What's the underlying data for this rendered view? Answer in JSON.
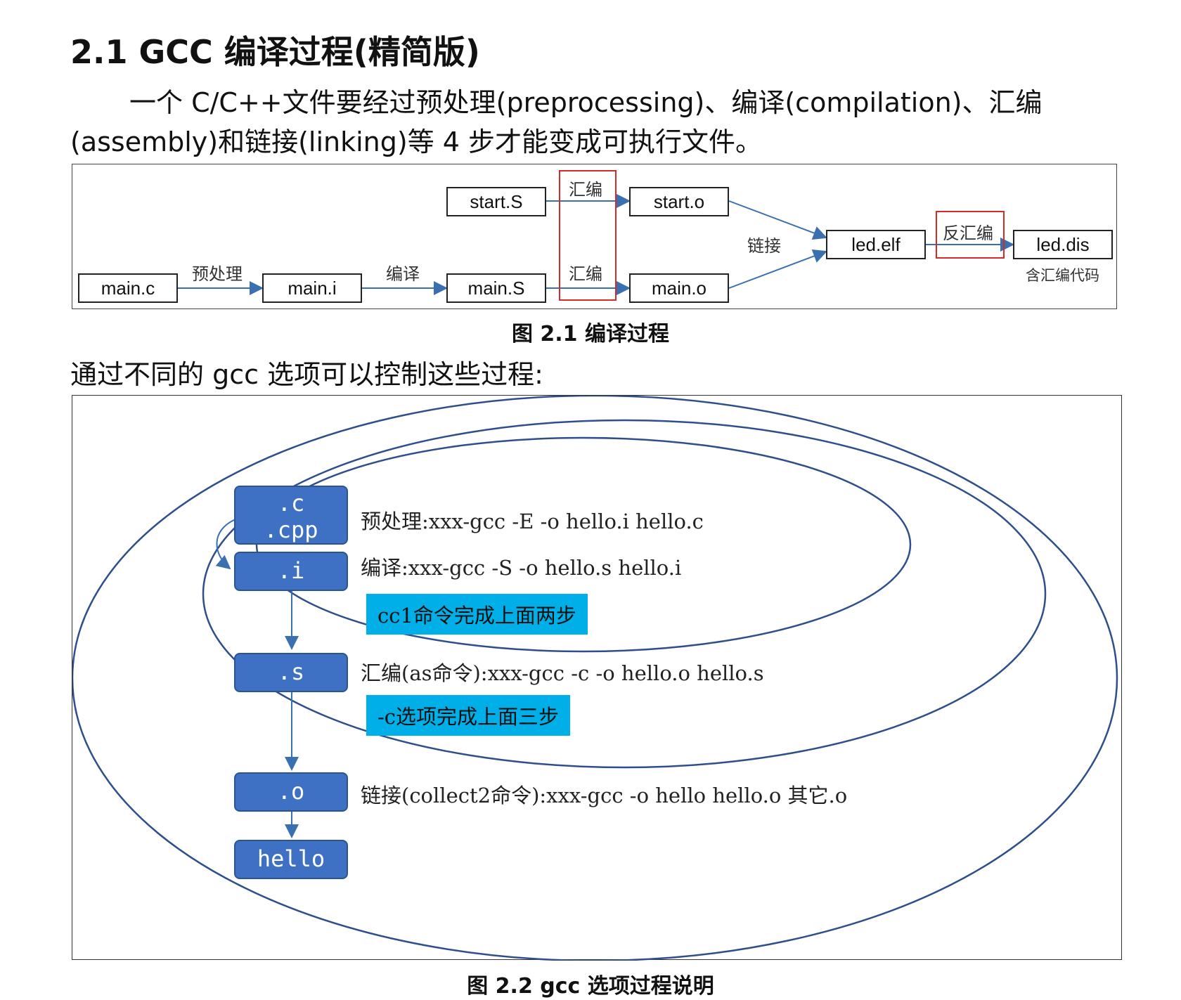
{
  "section_title": "2.1 GCC 编译过程(精简版)",
  "intro": "一个 C/C++文件要经过预处理(preprocessing)、编译(compilation)、汇编(assembly)和链接(linking)等 4 步才能变成可执行文件。",
  "figure1": {
    "files": {
      "main_c": "main.c",
      "main_i": "main.i",
      "main_S": "main.S",
      "main_o": "main.o",
      "start_S": "start.S",
      "start_o": "start.o",
      "led_elf": "led.elf",
      "led_dis": "led.dis"
    },
    "steps": {
      "preprocess": "预处理",
      "compile": "编译",
      "assemble_top": "汇编",
      "assemble_bottom": "汇编",
      "link": "链接",
      "disassemble": "反汇编",
      "dis_note": "含汇编代码"
    },
    "caption": "图 2.1 编译过程"
  },
  "lead_text": "通过不同的 gcc 选项可以控制这些过程:",
  "figure2": {
    "nodes": {
      "c": ".c",
      "cpp": ".cpp",
      "i": ".i",
      "s": ".s",
      "o": ".o",
      "hello": "hello"
    },
    "commands": {
      "preprocess": "预处理:xxx-gcc  -E  -o hello.i hello.c",
      "compile": "编译:xxx-gcc  -S  -o hello.s hello.i",
      "assemble": "汇编(as命令):xxx-gcc  -c  -o hello.o hello.s",
      "link": "链接(collect2命令):xxx-gcc  -o hello hello.o 其它.o"
    },
    "notes": {
      "cc1": "cc1命令完成上面两步",
      "c_option": "-c选项完成上面三步"
    },
    "caption": "图 2.2 gcc 选项过程说明"
  },
  "colors": {
    "node_blue": "#3e70c4",
    "note_cyan": "#00aee8",
    "ellipse": "#2e4f8c",
    "highlight_red": "#d42a2a",
    "arrow": "#3a6fb0"
  }
}
